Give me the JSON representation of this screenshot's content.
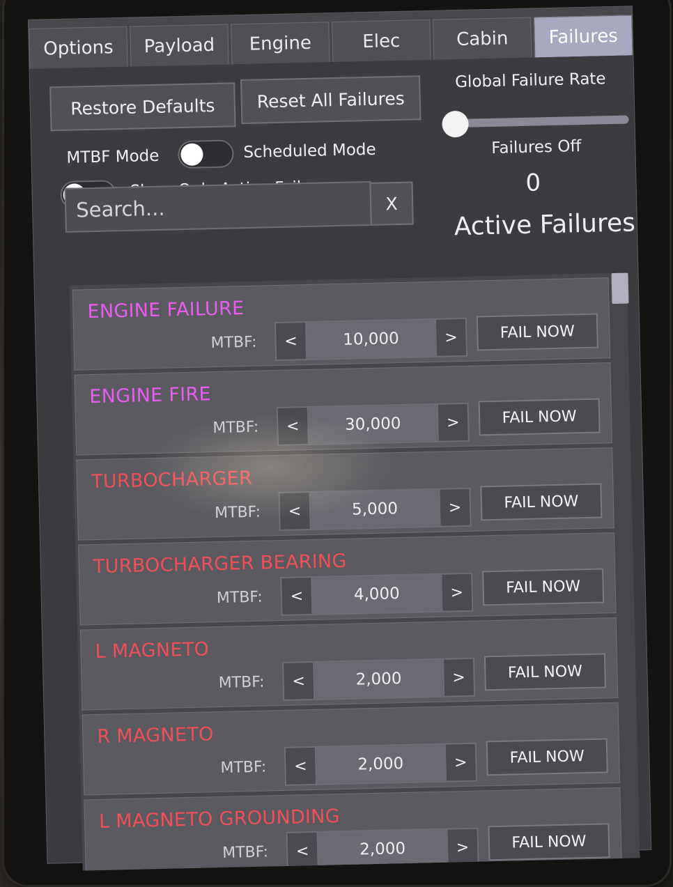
{
  "tabs": [
    "Options",
    "Payload",
    "Engine",
    "Elec",
    "Cabin",
    "Failures"
  ],
  "active_tab": "Failures",
  "buttons": {
    "restore_defaults": "Restore Defaults",
    "reset_all": "Reset All Failures"
  },
  "global_rate": {
    "label": "Global Failure Rate",
    "status": "Failures Off",
    "value": 0
  },
  "toggles": {
    "mtbf_mode": "MTBF Mode",
    "scheduled_mode": "Scheduled Mode",
    "show_active": "Show Only Active Failures"
  },
  "search": {
    "placeholder": "Search...",
    "clear_label": "X"
  },
  "active_failures": {
    "count": "0",
    "label": "Active Failures"
  },
  "colors": {
    "magenta": "#e85cf0",
    "red": "#f0505a"
  },
  "failures": [
    {
      "name": "ENGINE FAILURE",
      "color": "#e85cf0",
      "mtbf_label": "MTBF:",
      "mtbf": "10,000",
      "dec": "<",
      "inc": ">",
      "action": "FAIL NOW"
    },
    {
      "name": "ENGINE FIRE",
      "color": "#e85cf0",
      "mtbf_label": "MTBF:",
      "mtbf": "30,000",
      "dec": "<",
      "inc": ">",
      "action": "FAIL NOW"
    },
    {
      "name": "TURBOCHARGER",
      "color": "#f0505a",
      "mtbf_label": "MTBF:",
      "mtbf": "5,000",
      "dec": "<",
      "inc": ">",
      "action": "FAIL NOW"
    },
    {
      "name": "TURBOCHARGER BEARING",
      "color": "#f0505a",
      "mtbf_label": "MTBF:",
      "mtbf": "4,000",
      "dec": "<",
      "inc": ">",
      "action": "FAIL NOW"
    },
    {
      "name": "L MAGNETO",
      "color": "#f0505a",
      "mtbf_label": "MTBF:",
      "mtbf": "2,000",
      "dec": "<",
      "inc": ">",
      "action": "FAIL NOW"
    },
    {
      "name": "R MAGNETO",
      "color": "#f0505a",
      "mtbf_label": "MTBF:",
      "mtbf": "2,000",
      "dec": "<",
      "inc": ">",
      "action": "FAIL NOW"
    },
    {
      "name": "L MAGNETO GROUNDING",
      "color": "#f0505a",
      "mtbf_label": "MTBF:",
      "mtbf": "2,000",
      "dec": "<",
      "inc": ">",
      "action": "FAIL NOW"
    }
  ]
}
